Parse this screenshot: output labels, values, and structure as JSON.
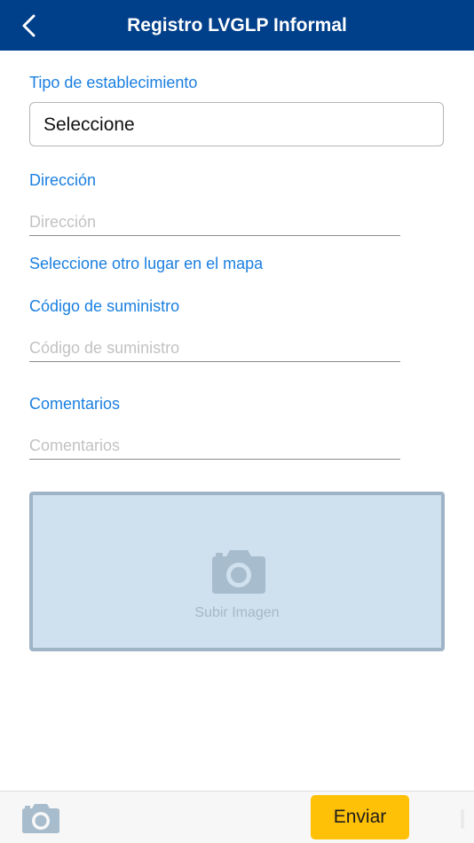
{
  "header": {
    "title": "Registro LVGLP Informal",
    "back_icon": "chevron-left-icon",
    "background_color": "#003f8a"
  },
  "form": {
    "tipo": {
      "label": "Tipo de establecimiento",
      "selected": "Seleccione"
    },
    "direccion": {
      "label": "Dirección",
      "placeholder": "Dirección",
      "value": ""
    },
    "map_link": "Seleccione otro lugar en el mapa",
    "codigo": {
      "label": "Código de suministro",
      "placeholder": "Código de suministro",
      "value": ""
    },
    "comentarios": {
      "label": "Comentarios",
      "placeholder": "Comentarios",
      "value": ""
    },
    "label_color": "#1a7fe0"
  },
  "upload": {
    "label": "Subir Imagen",
    "icon": "camera-icon"
  },
  "footer": {
    "camera_icon": "camera-icon",
    "send_label": "Enviar",
    "send_color": "#ffc107"
  }
}
